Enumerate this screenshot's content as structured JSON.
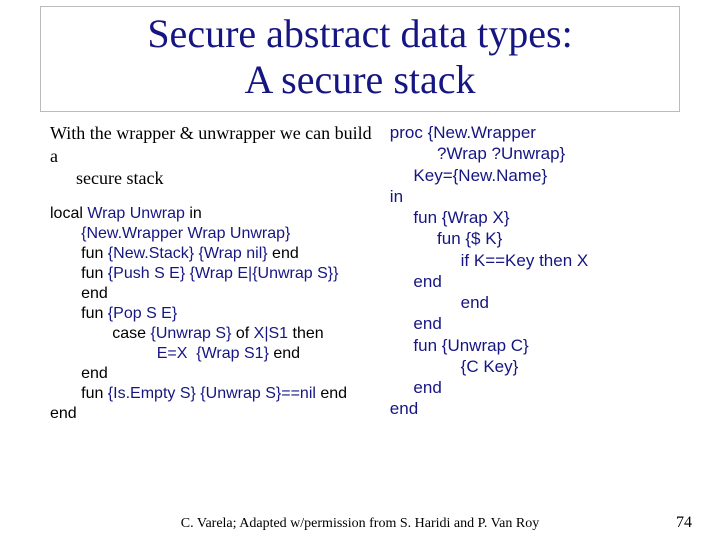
{
  "title": {
    "line1": "Secure abstract data types:",
    "line2": "A secure stack"
  },
  "intro": {
    "line1": "With the wrapper & unwrapper we can build a",
    "line2": "secure stack"
  },
  "left_code": {
    "l01a": "local",
    "l01b": " Wrap Unwrap ",
    "l01c": "in",
    "l02": "       {New.Wrapper Wrap Unwrap}",
    "l03a": "       fun",
    "l03b": " {New.Stack} {Wrap nil} ",
    "l03c": "end",
    "l04a": "       fun",
    "l04b": " {Push S E} {Wrap E|{Unwrap S}}",
    "l05": "       end",
    "l06a": "       fun",
    "l06b": " {Pop S E}",
    "l07a": "              case",
    "l07b": " {Unwrap S} ",
    "l07c": "of",
    "l07d": " X|S1 ",
    "l07e": "then",
    "l08a": "                        E=X  {Wrap S1} ",
    "l08b": "end",
    "l09": "       end",
    "l10a": "       fun",
    "l10b": " {Is.Empty S} {Unwrap S}==nil ",
    "l10c": "end",
    "l11": "end"
  },
  "right_code": {
    "r01": "proc {New.Wrapper",
    "r02": "          ?Wrap ?Unwrap}",
    "r03": "     Key={New.Name}",
    "r04": "in",
    "r05": "     fun {Wrap X}",
    "r06": "          fun {$ K}",
    "r07": "               if K==Key then X",
    "r08": "     end",
    "r09": "               end",
    "r10": "     end",
    "r11": "     fun {Unwrap C}",
    "r12": "               {C Key}",
    "r13": "     end",
    "r14": "end"
  },
  "footer": "C. Varela; Adapted w/permission from S. Haridi and P. Van Roy",
  "page_number": "74"
}
